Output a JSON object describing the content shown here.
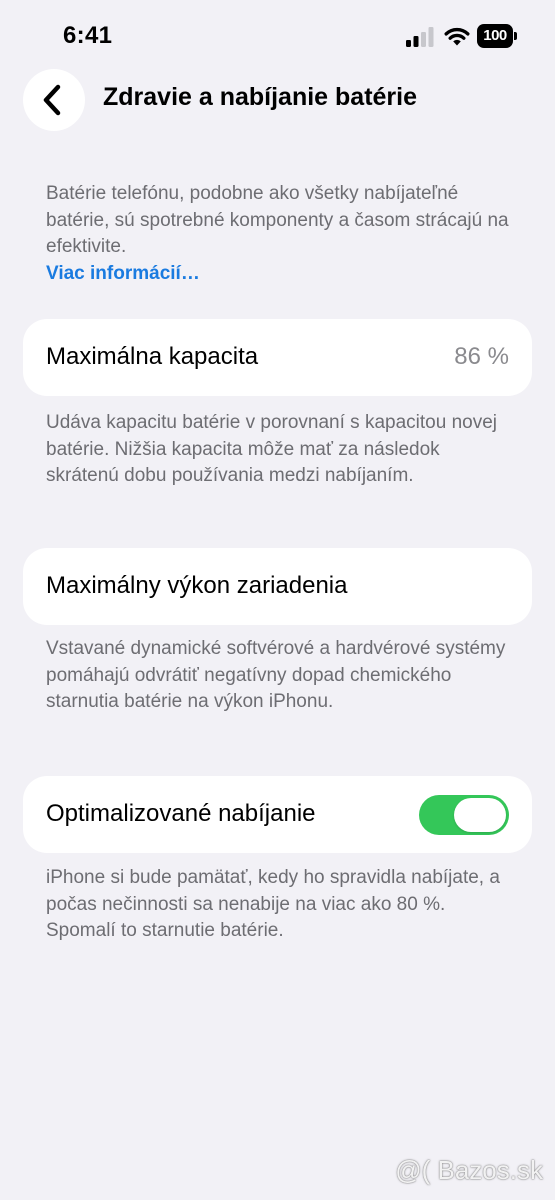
{
  "status_bar": {
    "time": "6:41",
    "battery_level": "100"
  },
  "header": {
    "back_icon": "chevron-left-icon",
    "title": "Zdravie a nabíjanie batérie"
  },
  "intro": {
    "text": "Batérie telefónu, podobne ako všetky nabíjateľné batérie, sú spotrebné komponenty a časom strácajú na efektivite.",
    "link": "Viac informácií…"
  },
  "max_capacity": {
    "label": "Maximálna kapacita",
    "value": "86 %",
    "description": "Udáva kapacitu batérie v porovnaní s kapacitou novej batérie. Nižšia kapacita môže mať za následok skrátenú dobu používania medzi nabíjaním."
  },
  "peak_performance": {
    "label": "Maximálny výkon zariadenia",
    "description": "Vstavané dynamické softvérové a hardvérové systémy pomáhajú odvrátiť negatívny dopad chemického starnutia batérie na výkon iPhonu."
  },
  "optimized_charging": {
    "label": "Optimalizované nabíjanie",
    "enabled": true,
    "toggle_color": "#34c759",
    "description": "iPhone si bude pamätať, kedy ho spravidla nabíjate, a počas nečinnosti sa nenabije na viac ako 80 %. Spomalí to starnutie batérie."
  },
  "colors": {
    "background": "#f2f1f6",
    "link": "#1a7be0",
    "secondary_text": "#6d6d72"
  },
  "watermark": "@( Bazos.sk"
}
